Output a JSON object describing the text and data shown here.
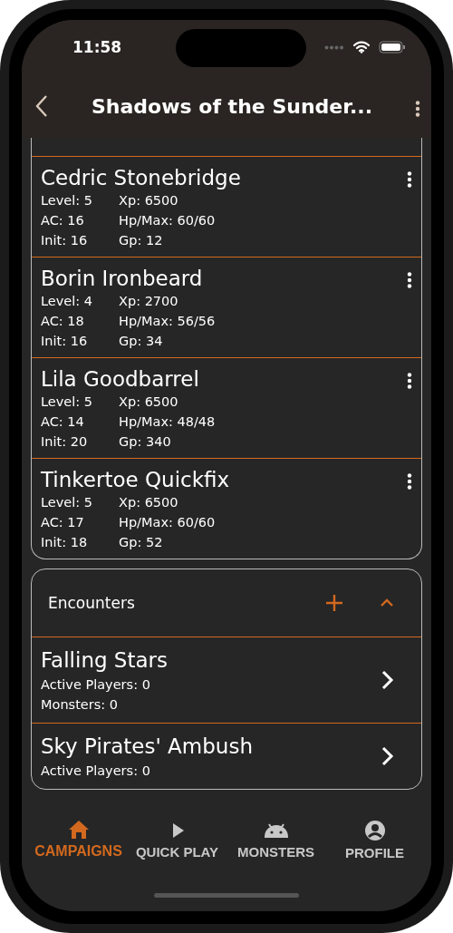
{
  "status_bar": {
    "time": "11:58"
  },
  "header": {
    "title": "Shadows of the Sunder..."
  },
  "players": [
    {
      "name": "Cedric Stonebridge",
      "stats": [
        "Level: 5",
        "Xp: 6500",
        "AC: 16",
        "Hp/Max: 60/60",
        "Init: 16",
        "Gp: 12"
      ]
    },
    {
      "name": "Borin Ironbeard",
      "stats": [
        "Level: 4",
        "Xp: 2700",
        "AC: 18",
        "Hp/Max: 56/56",
        "Init: 16",
        "Gp: 34"
      ]
    },
    {
      "name": "Lila Goodbarrel",
      "stats": [
        "Level: 5",
        "Xp: 6500",
        "AC: 14",
        "Hp/Max: 48/48",
        "Init: 20",
        "Gp: 340"
      ]
    },
    {
      "name": "Tinkertoe Quickfix",
      "stats": [
        "Level: 5",
        "Xp: 6500",
        "AC: 17",
        "Hp/Max: 60/60",
        "Init: 18",
        "Gp: 52"
      ]
    }
  ],
  "encounters": {
    "title": "Encounters",
    "expanded": true,
    "items": [
      {
        "name": "Falling Stars",
        "details": [
          "Active Players: 0",
          "Monsters: 0"
        ]
      },
      {
        "name": "Sky Pirates' Ambush",
        "details": [
          "Active Players: 0"
        ]
      }
    ]
  },
  "tabs": [
    {
      "label": "CAMPAIGNS",
      "kind": "home",
      "selected": true
    },
    {
      "label": "QUICK PLAY",
      "kind": "play",
      "selected": false
    },
    {
      "label": "MONSTERS",
      "kind": "robot",
      "selected": false
    },
    {
      "label": "PROFILE",
      "kind": "person",
      "selected": false
    }
  ]
}
